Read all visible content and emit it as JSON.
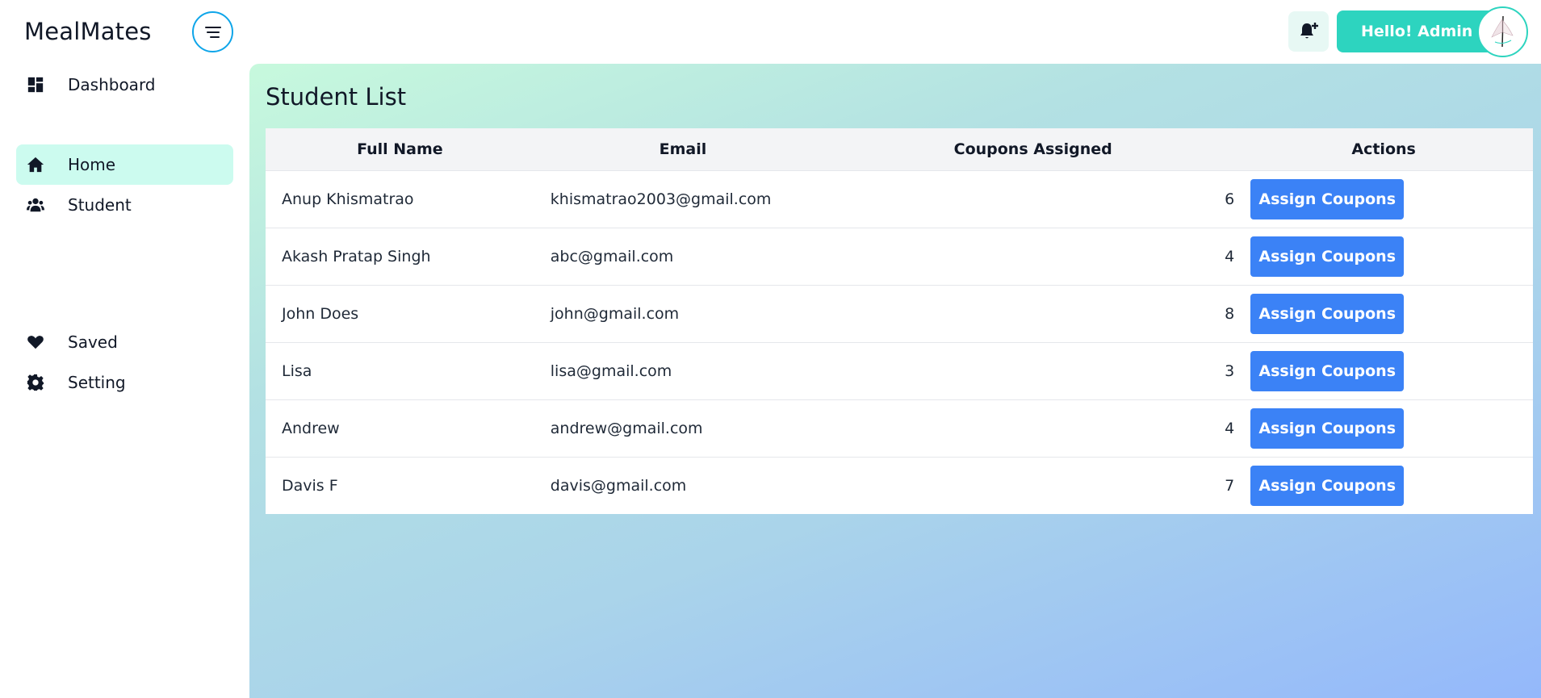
{
  "header": {
    "brand": "MealMates",
    "greeting": "Hello! Admin",
    "icons": {
      "menu": "menu-toggle-icon",
      "notification": "bell-plus-icon",
      "avatar": "avatar-logo"
    },
    "accent_color": "#2dd4bf"
  },
  "sidebar": {
    "items": [
      {
        "label": "Dashboard",
        "icon": "dashboard-icon",
        "active": false
      },
      {
        "label": "Home",
        "icon": "home-icon",
        "active": true
      },
      {
        "label": "Student",
        "icon": "users-icon",
        "active": false
      },
      {
        "label": "Saved",
        "icon": "heart-icon",
        "active": false
      },
      {
        "label": "Setting",
        "icon": "gear-icon",
        "active": false
      }
    ]
  },
  "main": {
    "title": "Student List",
    "table": {
      "columns": [
        "Full Name",
        "Email",
        "Coupons Assigned",
        "Actions"
      ],
      "rows": [
        {
          "name": "Anup Khismatrao",
          "email": "khismatrao2003@gmail.com",
          "coupons": "6",
          "action": "Assign Coupons"
        },
        {
          "name": "Akash Pratap Singh",
          "email": "abc@gmail.com",
          "coupons": "4",
          "action": "Assign Coupons"
        },
        {
          "name": "John Does",
          "email": "john@gmail.com",
          "coupons": "8",
          "action": "Assign Coupons"
        },
        {
          "name": "Lisa",
          "email": "lisa@gmail.com",
          "coupons": "3",
          "action": "Assign Coupons"
        },
        {
          "name": "Andrew",
          "email": "andrew@gmail.com",
          "coupons": "4",
          "action": "Assign Coupons"
        },
        {
          "name": "Davis F",
          "email": "davis@gmail.com",
          "coupons": "7",
          "action": "Assign Coupons"
        }
      ]
    },
    "button_color": "#3b82f6"
  }
}
